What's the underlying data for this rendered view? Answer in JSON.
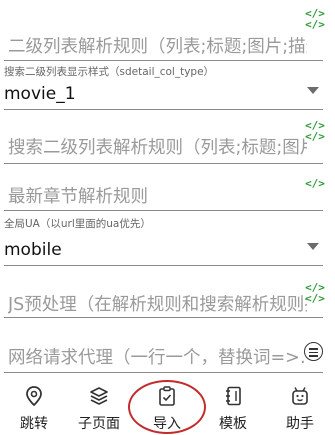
{
  "fields": {
    "f1": {
      "placeholder": "二级列表解析规则（列表;标题;图片;描述;…"
    },
    "f2": {
      "label": "搜索二级列表显示样式（sdetail_col_type）",
      "value": "movie_1"
    },
    "f3": {
      "placeholder": "搜索二级列表解析规则（列表;标题;图片;描…"
    },
    "f4": {
      "placeholder": "最新章节解析规则"
    },
    "f5": {
      "label": "全局UA（以url里面的ua优先）",
      "value": "mobile"
    },
    "f6": {
      "placeholder": "JS预处理（在解析规则和搜索解析规则执…"
    },
    "f7": {
      "placeholder": "网络请求代理（一行一个，替换词=>…"
    }
  },
  "code_icon": {
    "top": "</>",
    "bottom": "</>"
  },
  "bottom_nav": [
    {
      "label": "跳转",
      "icon": "location-pin-icon"
    },
    {
      "label": "子页面",
      "icon": "layers-icon"
    },
    {
      "label": "导入",
      "icon": "clipboard-check-icon",
      "highlighted": true
    },
    {
      "label": "模板",
      "icon": "notebook-icon"
    },
    {
      "label": "助手",
      "icon": "robot-icon"
    }
  ],
  "colors": {
    "code": "#2e9b3a",
    "highlight": "#c22c2c"
  }
}
